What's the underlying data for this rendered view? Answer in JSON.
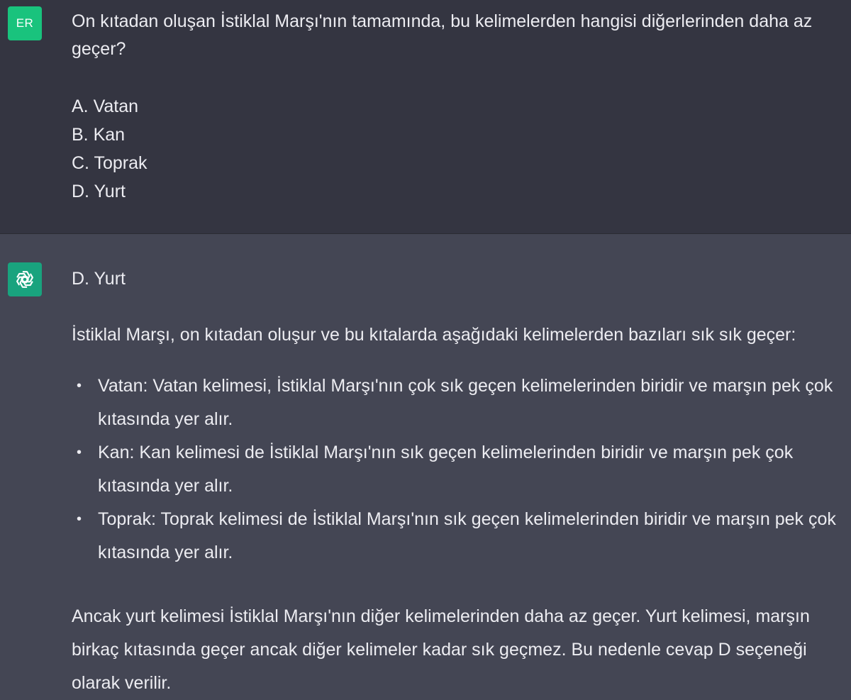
{
  "user": {
    "avatar_initials": "ER",
    "question": "On kıtadan oluşan İstiklal Marşı'nın tamamında, bu kelimelerden hangisi diğerlerinden daha az geçer?",
    "options": [
      "A. Vatan",
      "B. Kan",
      "C. Toprak",
      "D. Yurt"
    ]
  },
  "assistant": {
    "avatar_icon": "openai-logo-icon",
    "answer": "D. Yurt",
    "intro": "İstiklal Marşı, on kıtadan oluşur ve bu kıtalarda aşağıdaki kelimelerden bazıları sık sık geçer:",
    "bullets": [
      "Vatan: Vatan kelimesi, İstiklal Marşı'nın çok sık geçen kelimelerinden biridir ve marşın pek çok kıtasında yer alır.",
      "Kan: Kan kelimesi de İstiklal Marşı'nın sık geçen kelimelerinden biridir ve marşın pek çok kıtasında yer alır.",
      "Toprak: Toprak kelimesi de İstiklal Marşı'nın sık geçen kelimelerinden biridir ve marşın pek çok kıtasında yer alır."
    ],
    "conclusion": "Ancak yurt kelimesi İstiklal Marşı'nın diğer kelimelerinden daha az geçer. Yurt kelimesi, marşın birkaç kıtasında geçer ancak diğer kelimeler kadar sık geçmez. Bu nedenle cevap D seçeneği olarak verilir."
  },
  "colors": {
    "user_bg": "#343541",
    "assistant_bg": "#444654",
    "user_avatar": "#19c37d",
    "assistant_avatar": "#19a37e",
    "text": "#ececf1"
  }
}
